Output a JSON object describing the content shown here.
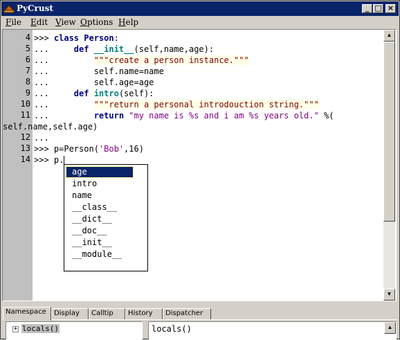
{
  "window": {
    "title": "PyCrust"
  },
  "title_buttons": {
    "minimize": "_",
    "maximize": "□",
    "close": "×"
  },
  "menu": [
    "File",
    "Edit",
    "View",
    "Options",
    "Help"
  ],
  "editor": {
    "lines": [
      {
        "num": "4",
        "segments": [
          {
            "t": ">>> ",
            "c": ""
          },
          {
            "t": "class ",
            "c": "kw"
          },
          {
            "t": "Person",
            "c": "cls"
          },
          {
            "t": ":",
            "c": ""
          }
        ]
      },
      {
        "num": "5",
        "segments": [
          {
            "t": "...     ",
            "c": ""
          },
          {
            "t": "def ",
            "c": "kw"
          },
          {
            "t": "__init__",
            "c": "fn"
          },
          {
            "t": "(self,name,age):",
            "c": ""
          }
        ]
      },
      {
        "num": "6",
        "segments": [
          {
            "t": "...         ",
            "c": ""
          },
          {
            "t": "\"\"\"create a person instance.\"\"\"",
            "c": "doc"
          }
        ]
      },
      {
        "num": "7",
        "segments": [
          {
            "t": "...         self.name=name",
            "c": ""
          }
        ]
      },
      {
        "num": "8",
        "segments": [
          {
            "t": "...         self.age=age",
            "c": ""
          }
        ]
      },
      {
        "num": "9",
        "segments": [
          {
            "t": "...     ",
            "c": ""
          },
          {
            "t": "def ",
            "c": "kw"
          },
          {
            "t": "intro",
            "c": "fn"
          },
          {
            "t": "(self):",
            "c": ""
          }
        ]
      },
      {
        "num": "10",
        "segments": [
          {
            "t": "...         ",
            "c": ""
          },
          {
            "t": "\"\"\"return a personal introdouction string.\"\"\"",
            "c": "doc"
          }
        ]
      },
      {
        "num": "11",
        "segments": [
          {
            "t": "...         ",
            "c": ""
          },
          {
            "t": "return ",
            "c": "kw"
          },
          {
            "t": "\"my name is %s and i am %s years old.\"",
            "c": "str"
          },
          {
            "t": " %(",
            "c": ""
          }
        ]
      },
      {
        "num": "",
        "segments": [
          {
            "t": "self.name,self.age)",
            "c": ""
          }
        ]
      },
      {
        "num": "12",
        "segments": [
          {
            "t": "...",
            "c": ""
          }
        ]
      },
      {
        "num": "13",
        "segments": [
          {
            "t": ">>> p=Person(",
            "c": ""
          },
          {
            "t": "'Bob'",
            "c": "str"
          },
          {
            "t": ",16)",
            "c": ""
          }
        ]
      },
      {
        "num": "14",
        "segments": [
          {
            "t": ">>> p.",
            "c": ""
          }
        ]
      }
    ]
  },
  "autocomplete": {
    "selected": "age",
    "items": [
      "age",
      "intro",
      "name",
      "__class__",
      "__dict__",
      "__doc__",
      "__init__",
      "__module__"
    ]
  },
  "tabs": [
    "Namespace",
    "Display",
    "Calltip",
    "History",
    "Dispatcher"
  ],
  "active_tab": "Namespace",
  "namespace_tree": {
    "expander": "+",
    "root": "locals()"
  },
  "detail_pane": {
    "text": "locals()"
  },
  "icons": {
    "app": "python-shell-icon",
    "scroll_up": "▲",
    "scroll_down": "▼"
  }
}
